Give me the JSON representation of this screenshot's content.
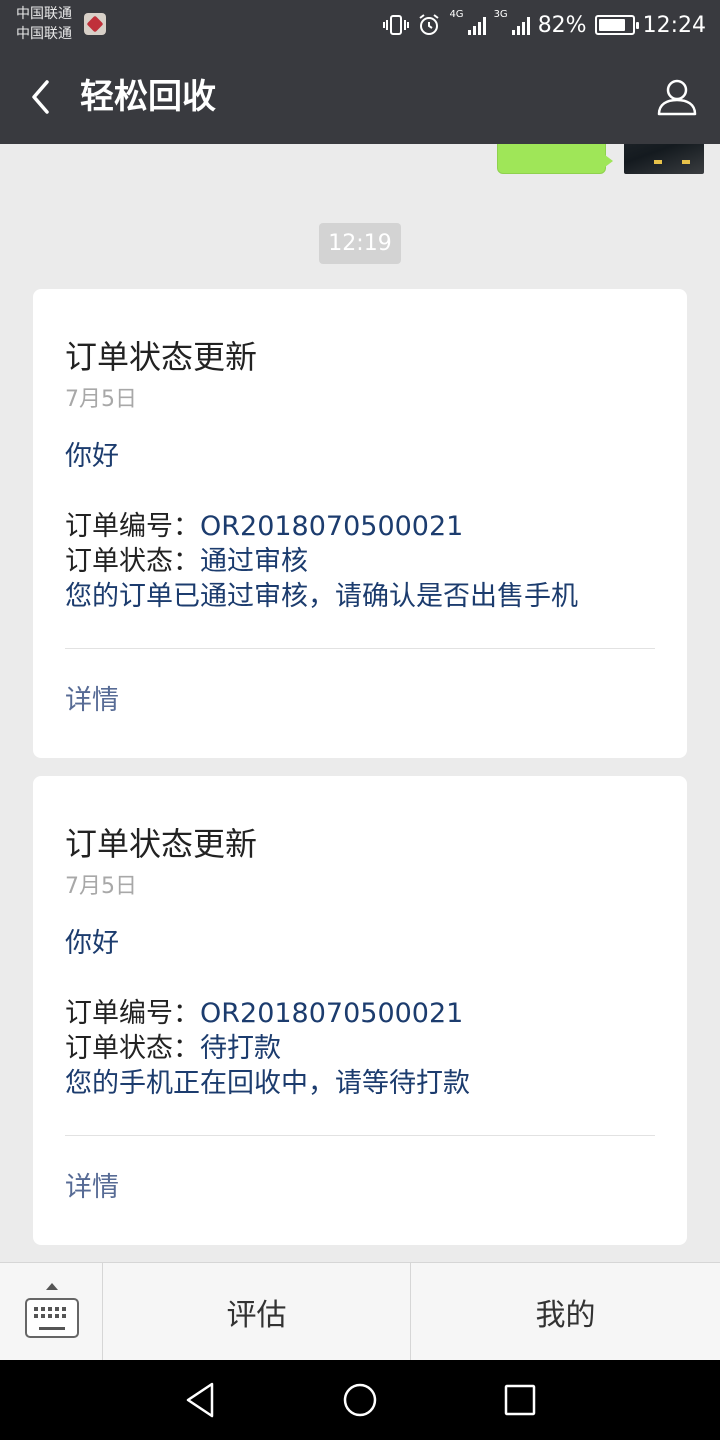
{
  "status_bar": {
    "carrier_1": "中国联通",
    "carrier_2": "中国联通",
    "net_a": "4G",
    "net_b": "3G",
    "battery_percent": "82%",
    "battery_level": 0.82,
    "time": "12:24",
    "icons": [
      "vibrate-icon",
      "alarm-icon",
      "signal-icon",
      "battery-icon"
    ]
  },
  "nav": {
    "title": "轻松回收",
    "back_icon": "chevron-left-icon",
    "profile_icon": "user-icon"
  },
  "chat": {
    "timestamp": "12:19",
    "cards": [
      {
        "title": "订单状态更新",
        "date": "7月5日",
        "greeting": "你好",
        "order_label": "订单编号：",
        "order_value": "OR2018070500021",
        "status_label": "订单状态：",
        "status_value": "通过审核",
        "message": "您的订单已通过审核，请确认是否出售手机",
        "link": "详情"
      },
      {
        "title": "订单状态更新",
        "date": "7月5日",
        "greeting": "你好",
        "order_label": "订单编号：",
        "order_value": "OR2018070500021",
        "status_label": "订单状态：",
        "status_value": "待打款",
        "message": "您的手机正在回收中，请等待打款",
        "link": "详情"
      }
    ]
  },
  "menu": {
    "keyboard_icon": "keyboard-icon",
    "item_1": "评估",
    "item_2": "我的"
  },
  "system_nav": [
    "back-triangle-icon",
    "home-circle-icon",
    "recents-square-icon"
  ],
  "colors": {
    "bar_bg": "#393a3f",
    "chat_bg": "#ebebeb",
    "link": "#576b95",
    "value_text": "#1c3c6e",
    "own_bubble": "#9fe658"
  }
}
